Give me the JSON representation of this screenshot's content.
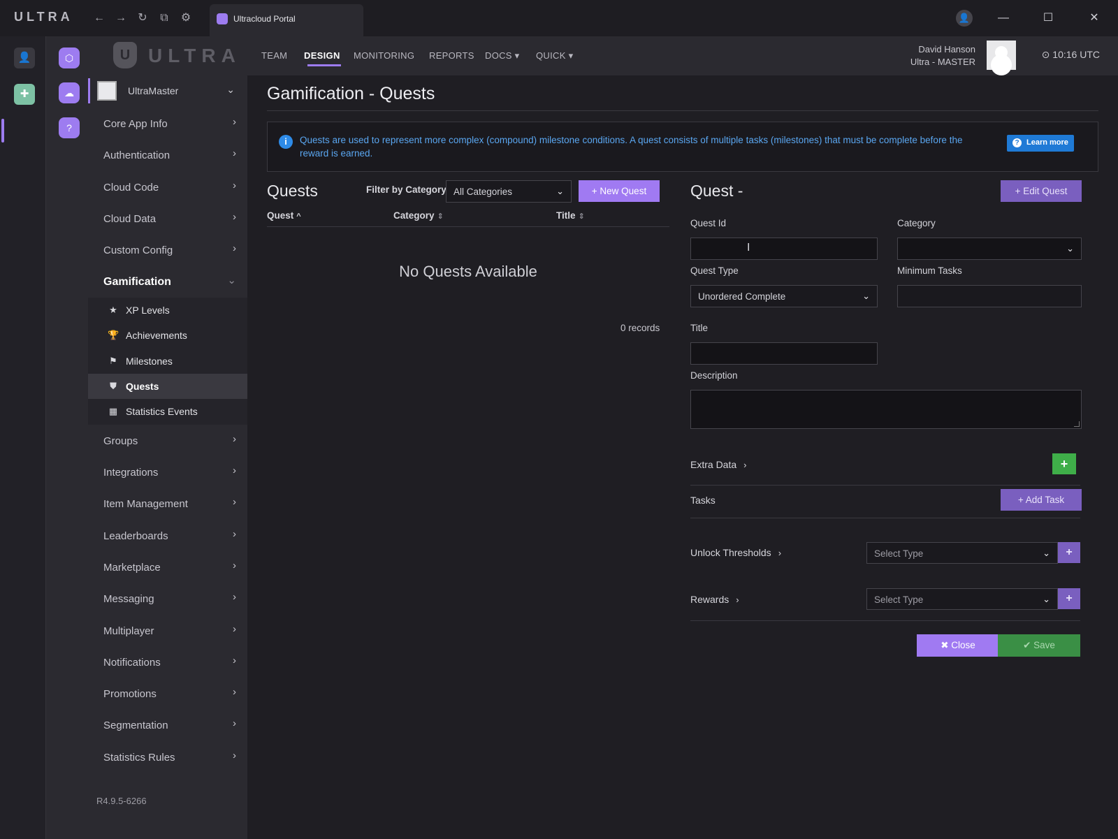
{
  "browser": {
    "brand": "ULTRA",
    "tab_title": "Ultracloud Portal"
  },
  "sidebar": {
    "logo_text": "ULTRA",
    "logo_letter": "U",
    "app_name": "UltraMaster",
    "menu": [
      {
        "label": "Core App Info"
      },
      {
        "label": "Authentication"
      },
      {
        "label": "Cloud Code"
      },
      {
        "label": "Cloud Data"
      },
      {
        "label": "Custom Config"
      }
    ],
    "open_section": "Gamification",
    "submenu": [
      {
        "label": "XP Levels",
        "icon": "star-icon",
        "glyph": "★"
      },
      {
        "label": "Achievements",
        "icon": "trophy-icon",
        "glyph": "🏆"
      },
      {
        "label": "Milestones",
        "icon": "flags-icon",
        "glyph": "⚑"
      },
      {
        "label": "Quests",
        "icon": "shield-icon",
        "glyph": "⛊"
      },
      {
        "label": "Statistics Events",
        "icon": "calendar-icon",
        "glyph": "▦"
      }
    ],
    "menu_after": [
      {
        "label": "Groups"
      },
      {
        "label": "Integrations"
      },
      {
        "label": "Item Management"
      },
      {
        "label": "Leaderboards"
      },
      {
        "label": "Marketplace"
      },
      {
        "label": "Messaging"
      },
      {
        "label": "Multiplayer"
      },
      {
        "label": "Notifications"
      },
      {
        "label": "Promotions"
      },
      {
        "label": "Segmentation"
      },
      {
        "label": "Statistics Rules"
      }
    ],
    "version": "R4.9.5-6266"
  },
  "topnav": {
    "items": [
      "TEAM",
      "DESIGN",
      "MONITORING",
      "REPORTS",
      "DOCS ▾",
      "QUICK ▾"
    ],
    "active": "DESIGN",
    "user_name": "David Hanson",
    "user_app": "Ultra - MASTER",
    "time": "⊙ 10:16 UTC"
  },
  "page": {
    "title": "Gamification - Quests",
    "info_text": "Quests are used to represent more complex (compound) milestone conditions. A quest consists of multiple tasks (milestones) that must be complete before the reward is earned.",
    "learn_more": "Learn more"
  },
  "quest_list": {
    "title": "Quests",
    "filter_label": "Filter by Category:",
    "filter_value": "All Categories",
    "new_button": "+ New Quest",
    "columns": [
      "Quest",
      "Category",
      "Title"
    ],
    "empty_message": "No Quests Available",
    "records": "0 records"
  },
  "quest_form": {
    "title": "Quest -",
    "edit_button": "+ Edit Quest",
    "quest_id_label": "Quest Id",
    "quest_id_value": "",
    "category_label": "Category",
    "category_value": "",
    "quest_type_label": "Quest Type",
    "quest_type_value": "Unordered Complete",
    "min_tasks_label": "Minimum Tasks",
    "min_tasks_value": "",
    "title_label": "Title",
    "title_value": "",
    "description_label": "Description",
    "description_value": "",
    "extra_data_label": "Extra Data",
    "tasks_label": "Tasks",
    "add_task_button": "+ Add Task",
    "unlock_label": "Unlock Thresholds",
    "unlock_select": "Select Type",
    "rewards_label": "Rewards",
    "rewards_select": "Select Type",
    "close_button": "✖ Close",
    "save_button": "✔ Save"
  },
  "colors": {
    "accent": "#9d7cf0",
    "info_blue": "#5aa6f0",
    "success_green": "#3fae49"
  }
}
